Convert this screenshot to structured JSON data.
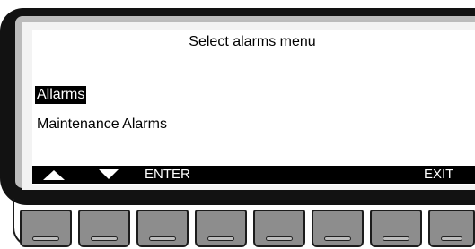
{
  "screen": {
    "title": "Select alarms menu",
    "items": [
      {
        "label": "Allarms",
        "selected": true
      },
      {
        "label": "Maintenance Alarms",
        "selected": false
      }
    ]
  },
  "softkeys": {
    "up_icon": "triangle-up-icon",
    "down_icon": "triangle-down-icon",
    "enter_label": "ENTER",
    "exit_label": "EXIT"
  },
  "hardware_buttons": [
    {
      "name": "softkey-button-1"
    },
    {
      "name": "softkey-button-2"
    },
    {
      "name": "softkey-button-3"
    },
    {
      "name": "softkey-button-4"
    },
    {
      "name": "softkey-button-5"
    },
    {
      "name": "softkey-button-6"
    },
    {
      "name": "softkey-button-7"
    },
    {
      "name": "softkey-button-8"
    }
  ],
  "colors": {
    "bezel": "#121212",
    "frame": "#bcbcbc",
    "lcd_background": "#ffffff",
    "button": "#8d8d8d"
  }
}
